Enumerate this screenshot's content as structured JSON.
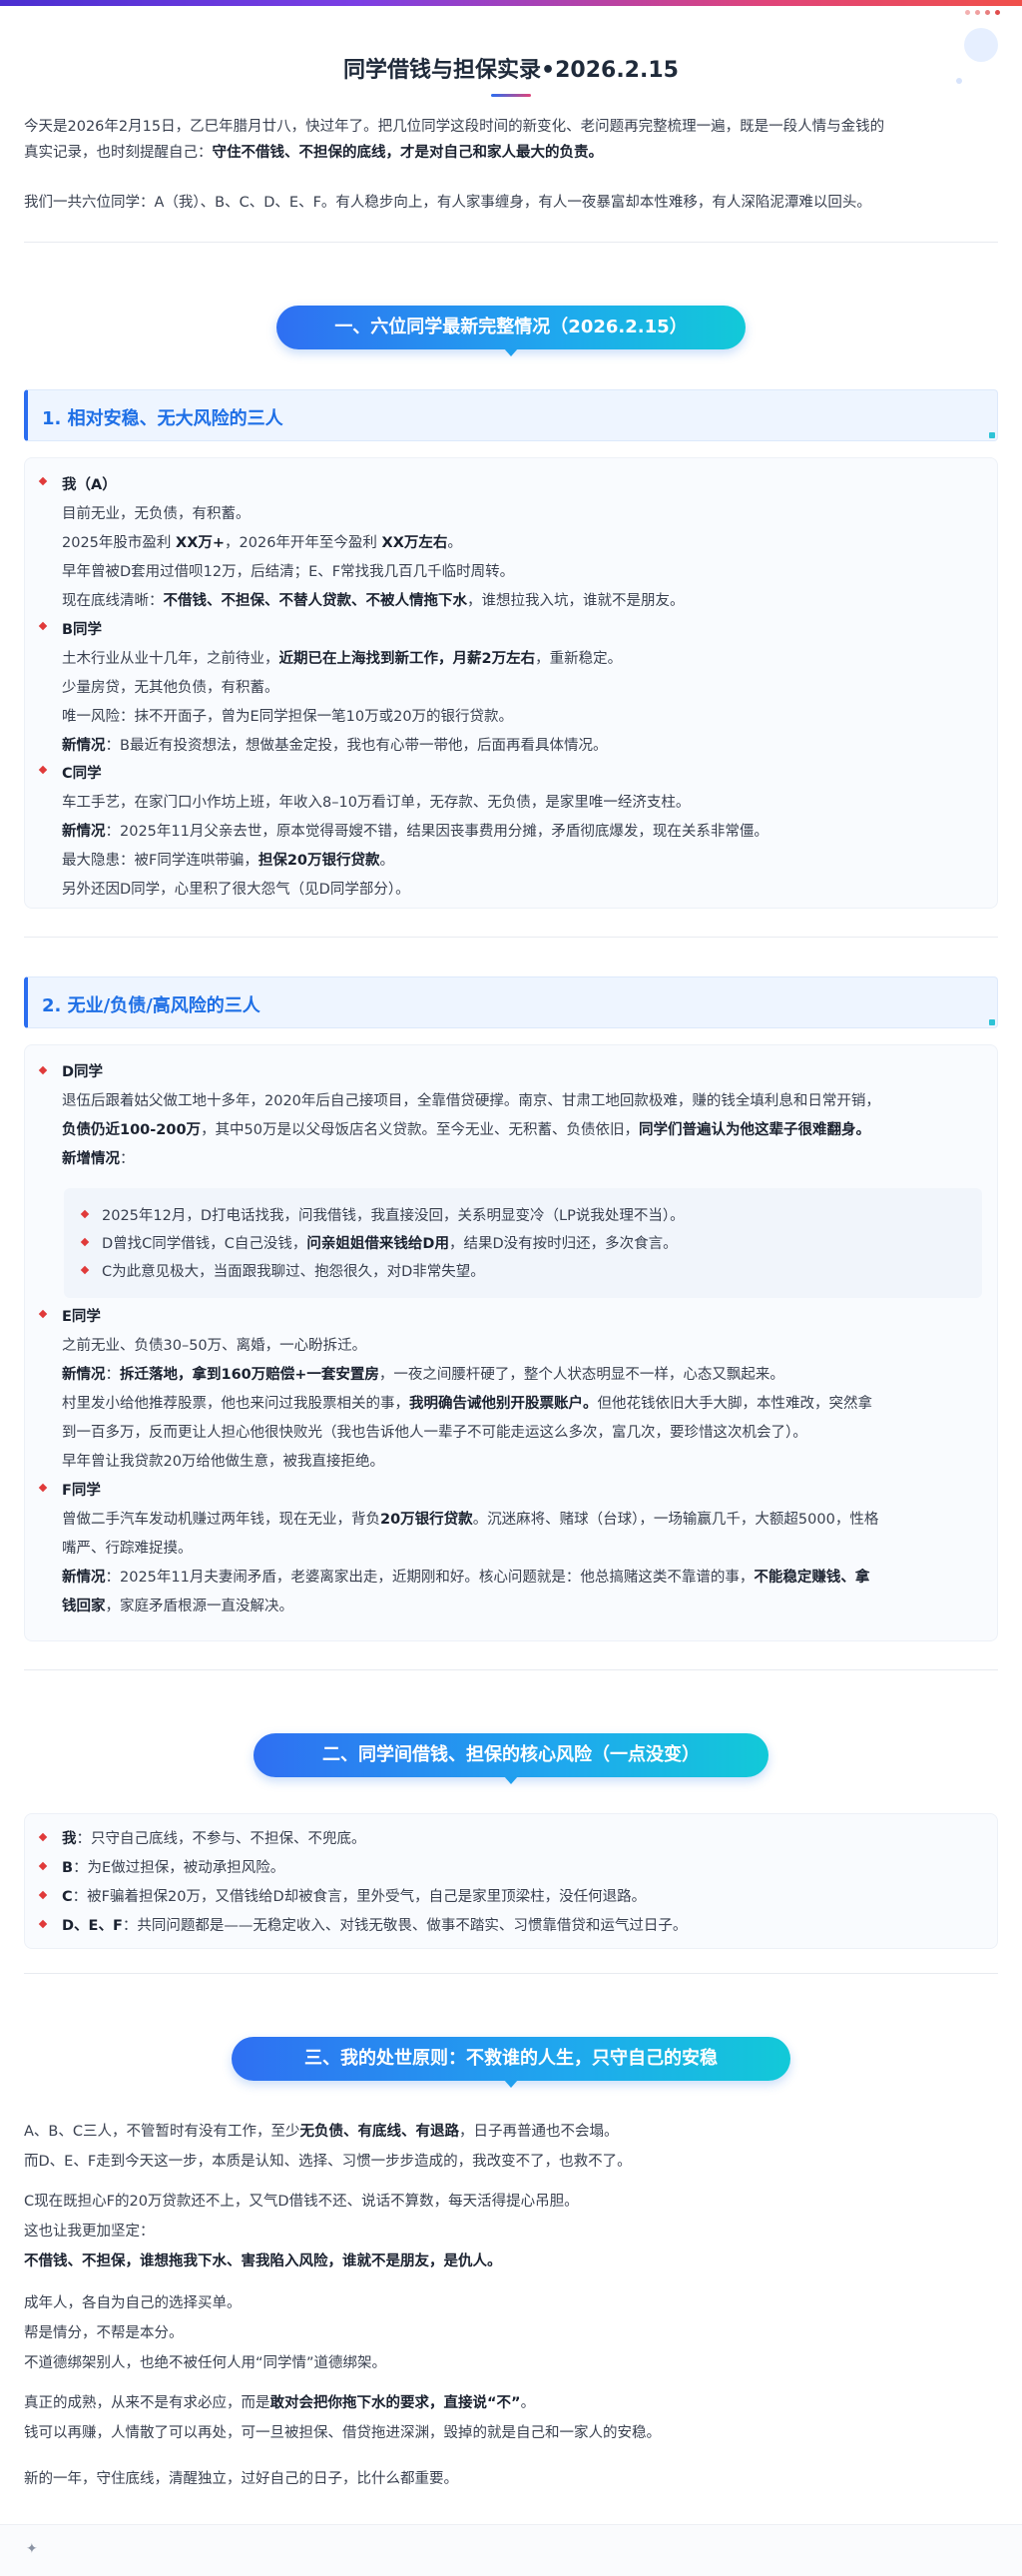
{
  "header": {
    "title": "同学借钱与担保实录•2026.2.15"
  },
  "intro": {
    "p1a": "今天是2026年2月15日，乙巳年腊月廿八，快过年了。把几位同学这段时间的新变化、老问题再完整梳理一遍，既是一段人情与金钱的",
    "p1b_pre": "真实记录，也时刻提醒自己：",
    "p1b_bold": "守住不借钱、不担保的底线，才是对自己和家人最大的负责。",
    "p2": "我们一共六位同学：A（我）、B、C、D、E、F。有人稳步向上，有人家事缠身，有人一夜暴富却本性难移，有人深陷泥潭难以回头。"
  },
  "section1": {
    "pill": "一、六位同学最新完整情况（2026.2.15）",
    "group1_title": "1. 相对安稳、无大风险的三人",
    "a": {
      "name": "我（A）",
      "l1": "目前无业，无负债，有积蓄。",
      "l2_pre": "2025年股市盈利 ",
      "l2_b1": "XX万+",
      "l2_mid": "，2026年开年至今盈利 ",
      "l2_b2": "XX万左右",
      "l2_post": "。",
      "l3": "早年曾被D套用过借呗12万，后结清；E、F常找我几百几千临时周转。",
      "l4_pre": "现在底线清晰：",
      "l4_bold": "不借钱、不担保、不替人贷款、不被人情拖下水",
      "l4_post": "，谁想拉我入坑，谁就不是朋友。"
    },
    "b": {
      "name": "B同学",
      "l1_pre": "土木行业从业十几年，之前待业，",
      "l1_bold": "近期已在上海找到新工作，月薪2万左右",
      "l1_post": "，重新稳定。",
      "l2": "少量房贷，无其他负债，有积蓄。",
      "l3": "唯一风险：抹不开面子，曾为E同学担保一笔10万或20万的银行贷款。",
      "l4_label": "新情况",
      "l4_text": "：B最近有投资想法，想做基金定投，我也有心带一带他，后面再看具体情况。"
    },
    "c": {
      "name": "C同学",
      "l1": "车工手艺，在家门口小作坊上班，年收入8–10万看订单，无存款、无负债，是家里唯一经济支柱。",
      "l2_label": "新情况",
      "l2_text": "：2025年11月父亲去世，原本觉得哥嫂不错，结果因丧事费用分摊，矛盾彻底爆发，现在关系非常僵。",
      "l3_pre": "最大隐患：被F同学连哄带骗，",
      "l3_bold": "担保20万银行贷款",
      "l3_post": "。",
      "l4": "另外还因D同学，心里积了很大怨气（见D同学部分）。"
    },
    "group2_title": "2. 无业/负债/高风险的三人",
    "d": {
      "name": "D同学",
      "l1": "退伍后跟着姑父做工地十多年，2020年后自己接项目，全靠借贷硬撑。南京、甘肃工地回款极难，赚的钱全填利息和日常开销，",
      "l2_b1": "负债仍近100-200万",
      "l2_mid": "，其中50万是以父母饭店名义贷款。至今无业、无积蓄、负债依旧，",
      "l2_b2": "同学们普遍认为他这辈子很难翻身。",
      "l3_label": "新增情况",
      "l3_text": "：",
      "s1": "2025年12月，D打电话找我，问我借钱，我直接没回，关系明显变冷（LP说我处理不当）。",
      "s2_pre": "D曾找C同学借钱，C自己没钱，",
      "s2_bold": "问亲姐姐借来钱给D用",
      "s2_post": "，结果D没有按时归还，多次食言。",
      "s3": "C为此意见极大，当面跟我聊过、抱怨很久，对D非常失望。"
    },
    "e": {
      "name": "E同学",
      "l1": "之前无业、负债30–50万、离婚，一心盼拆迁。",
      "l2_label": "新情况",
      "l2_text": "：",
      "l2_bold": "拆迁落地，拿到160万赔偿+一套安置房",
      "l2_post": "，一夜之间腰杆硬了，整个人状态明显不一样，心态又飘起来。",
      "l3_pre": "村里发小给他推荐股票，他也来问过我股票相关的事，",
      "l3_bold": "我明确告诫他别开股票账户。",
      "l3_post": "但他花钱依旧大手大脚，本性难改，突然拿",
      "l4": "到一百多万，反而更让人担心他很快败光（我也告诉他人一辈子不可能走运这么多次，富几次，要珍惜这次机会了）。",
      "l5": "早年曾让我贷款20万给他做生意，被我直接拒绝。"
    },
    "f": {
      "name": "F同学",
      "l1_pre": "曾做二手汽车发动机赚过两年钱，现在无业，背负",
      "l1_bold": "20万银行贷款",
      "l1_post": "。沉迷麻将、赌球（台球），一场输赢几千，大额超5000，性格",
      "l2": "嘴严、行踪难捉摸。",
      "l3_label": "新情况",
      "l3_text": "：2025年11月夫妻闹矛盾，老婆离家出走，近期刚和好。核心问题就是：他总搞赌这类不靠谱的事，",
      "l3_bold": "不能稳定赚钱、拿",
      "l4_bold": "钱回家",
      "l4_post": "，家庭矛盾根源一直没解决。"
    }
  },
  "section2": {
    "pill": "二、同学间借钱、担保的核心风险（一点没变）",
    "r1_b": "我",
    "r1": "：只守自己底线，不参与、不担保、不兜底。",
    "r2_b": "B",
    "r2": "：为E做过担保，被动承担风险。",
    "r3_b": "C",
    "r3": "：被F骗着担保20万，又借钱给D却被食言，里外受气，自己是家里顶梁柱，没任何退路。",
    "r4_b": "D、E、F",
    "r4": "：共同问题都是——无稳定收入、对钱无敬畏、做事不踏实、习惯靠借贷和运气过日子。"
  },
  "section3": {
    "pill": "三、我的处世原则：不救谁的人生，只守自己的安稳",
    "p1_pre": "A、B、C三人，不管暂时有没有工作，至少",
    "p1_bold": "无负债、有底线、有退路",
    "p1_post": "，日子再普通也不会塌。",
    "p2": "而D、E、F走到今天这一步，本质是认知、选择、习惯一步步造成的，我改变不了，也救不了。",
    "p3": "C现在既担心F的20万贷款还不上，又气D借钱不还、说话不算数，每天活得提心吊胆。",
    "p4": "这也让我更加坚定：",
    "p5_bold": "不借钱、不担保，谁想拖我下水、害我陷入风险，谁就不是朋友，是仇人。",
    "p6": "成年人，各自为自己的选择买单。",
    "p7": "帮是情分，不帮是本分。",
    "p8": "不道德绑架别人，也绝不被任何人用“同学情”道德绑架。",
    "p9_pre": "真正的成熟，从来不是有求必应，而是",
    "p9_bold": "敢对会把你拖下水的要求，直接说“不”",
    "p9_post": "。",
    "p10": "钱可以再赚，人情散了可以再处，可一旦被担保、借贷拖进深渊，毁掉的就是自己和一家人的安稳。",
    "p11": "新的一年，守住底线，清醒独立，过好自己的日子，比什么都重要。"
  },
  "footer": {
    "icon": "sparkle-icon",
    "glyph": "✦"
  },
  "colors": {
    "accent": "#2a6df0",
    "bullet": "#e03a3a",
    "pill_start": "#2f6ff2",
    "pill_end": "#12c9d8"
  }
}
